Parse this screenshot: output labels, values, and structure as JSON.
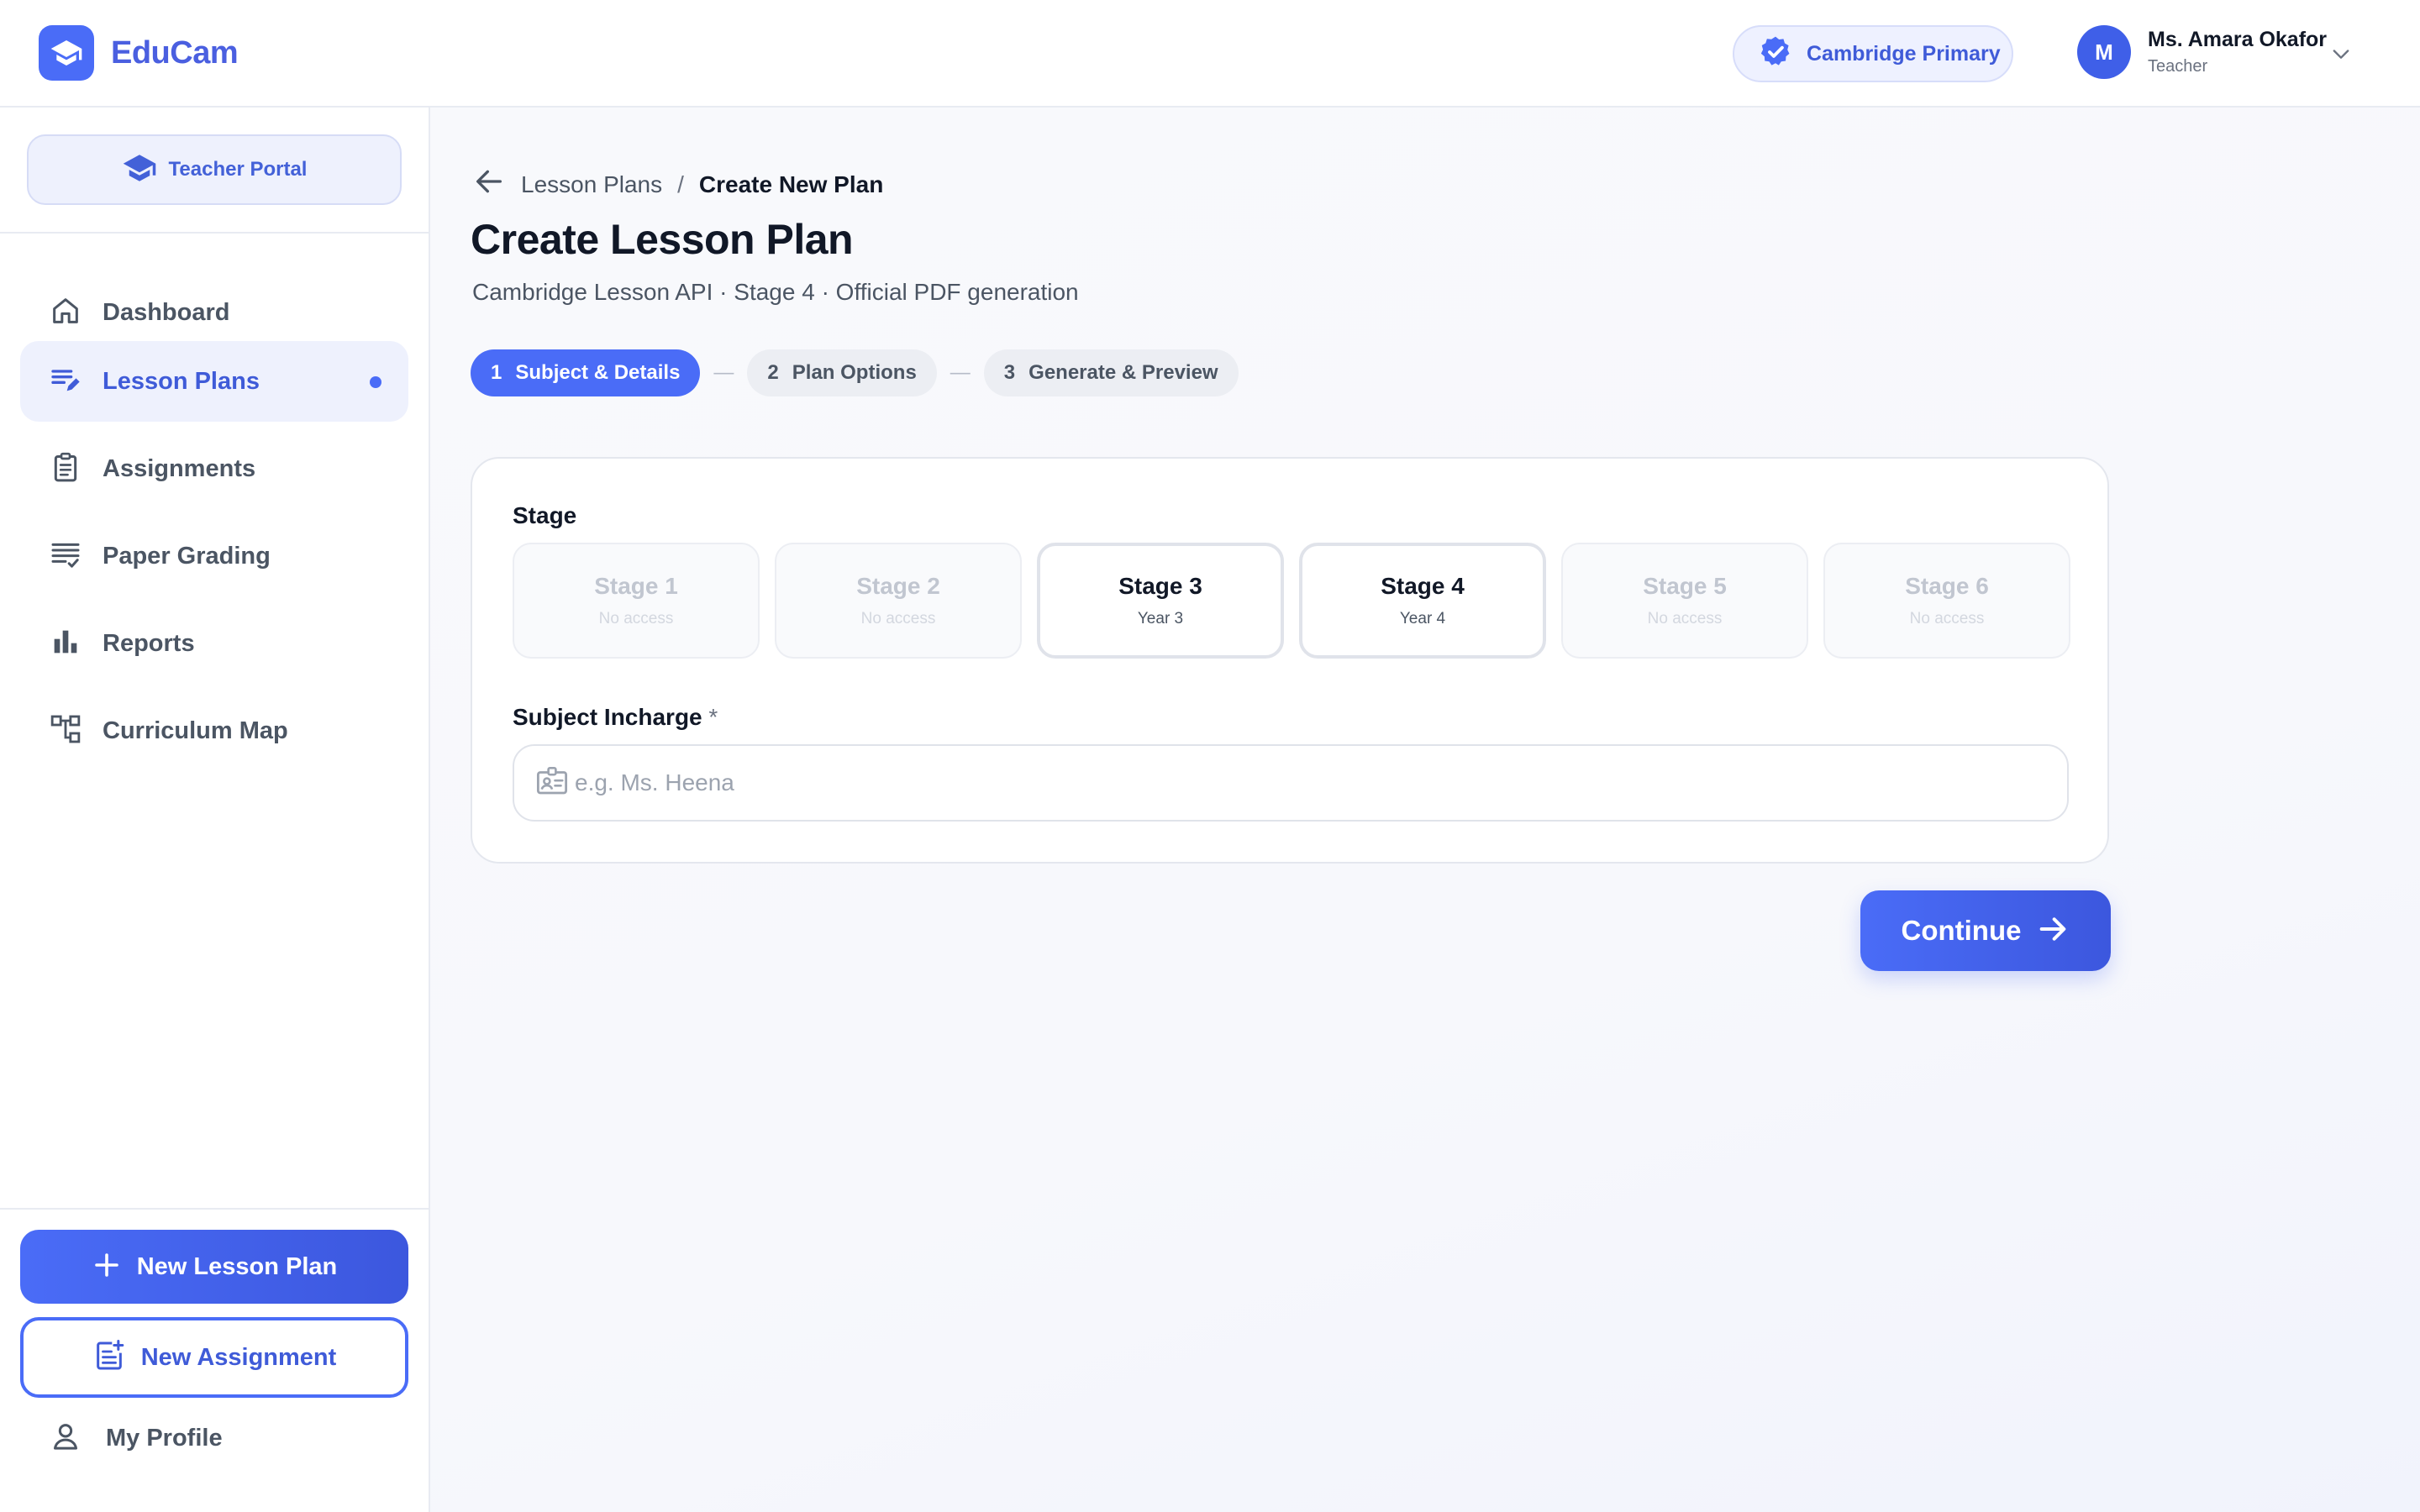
{
  "app": {
    "name": "EduCam"
  },
  "header": {
    "school_badge": "Cambridge Primary",
    "user": {
      "initial": "M",
      "name": "Ms. Amara Okafor",
      "role": "Teacher"
    }
  },
  "sidebar": {
    "portal_label": "Teacher Portal",
    "items": [
      {
        "label": "Dashboard",
        "icon": "home-icon",
        "active": false
      },
      {
        "label": "Lesson Plans",
        "icon": "edit-list-icon",
        "active": true
      },
      {
        "label": "Assignments",
        "icon": "clipboard-icon",
        "active": false
      },
      {
        "label": "Paper Grading",
        "icon": "checklist-icon",
        "active": false
      },
      {
        "label": "Reports",
        "icon": "bar-chart-icon",
        "active": false
      },
      {
        "label": "Curriculum Map",
        "icon": "hierarchy-icon",
        "active": false
      }
    ],
    "new_lesson_plan": "New Lesson Plan",
    "new_assignment": "New Assignment",
    "my_profile": "My Profile"
  },
  "breadcrumb": {
    "parent": "Lesson Plans",
    "separator": "/",
    "current": "Create New Plan"
  },
  "page": {
    "title": "Create Lesson Plan",
    "subtitle": "Cambridge Lesson API · Stage 4 · Official PDF generation"
  },
  "steps": [
    {
      "num": "1",
      "label": "Subject & Details",
      "active": true
    },
    {
      "num": "2",
      "label": "Plan Options",
      "active": false
    },
    {
      "num": "3",
      "label": "Generate & Preview",
      "active": false
    }
  ],
  "step_separator": "—",
  "form": {
    "stage_label": "Stage",
    "stages": [
      {
        "name": "Stage 1",
        "sub": "No access",
        "enabled": false
      },
      {
        "name": "Stage 2",
        "sub": "No access",
        "enabled": false
      },
      {
        "name": "Stage 3",
        "sub": "Year 3",
        "enabled": true
      },
      {
        "name": "Stage 4",
        "sub": "Year 4",
        "enabled": true
      },
      {
        "name": "Stage 5",
        "sub": "No access",
        "enabled": false
      },
      {
        "name": "Stage 6",
        "sub": "No access",
        "enabled": false
      }
    ],
    "subject_incharge_label": "Subject Incharge",
    "required_marker": "*",
    "subject_incharge_value": "",
    "subject_incharge_placeholder": "e.g. Ms. Heena",
    "continue_label": "Continue"
  },
  "colors": {
    "accent": "#4a6cf7",
    "accent_dark": "#3c57de",
    "active_bg": "#eef1fd"
  }
}
